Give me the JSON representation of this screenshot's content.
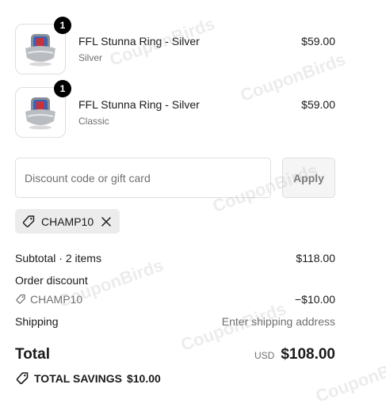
{
  "items": [
    {
      "quantity": "1",
      "title": "FFL Stunna Ring - Silver",
      "variant": "Silver",
      "price": "$59.00"
    },
    {
      "quantity": "1",
      "title": "FFL Stunna Ring - Silver",
      "variant": "Classic",
      "price": "$59.00"
    }
  ],
  "discount": {
    "placeholder": "Discount code or gift card",
    "value": "",
    "apply_label": "Apply",
    "applied_code": "CHAMP10"
  },
  "summary": {
    "subtotal_label": "Subtotal · 2 items",
    "subtotal_value": "$118.00",
    "order_discount_label": "Order discount",
    "discount_code": "CHAMP10",
    "discount_value": "−$10.00",
    "shipping_label": "Shipping",
    "shipping_value": "Enter shipping address",
    "total_label": "Total",
    "currency": "USD",
    "total_value": "$108.00",
    "savings_label": "TOTAL SAVINGS",
    "savings_value": "$10.00"
  },
  "watermark": {
    "text": "CouponBirds"
  },
  "icons": {
    "tag": "tag-icon",
    "remove": "close-icon",
    "ring": "product-ring-image"
  },
  "colors": {
    "text": "#1a1a1a",
    "muted": "#707070",
    "badge": "#000000",
    "border": "#dedede"
  }
}
